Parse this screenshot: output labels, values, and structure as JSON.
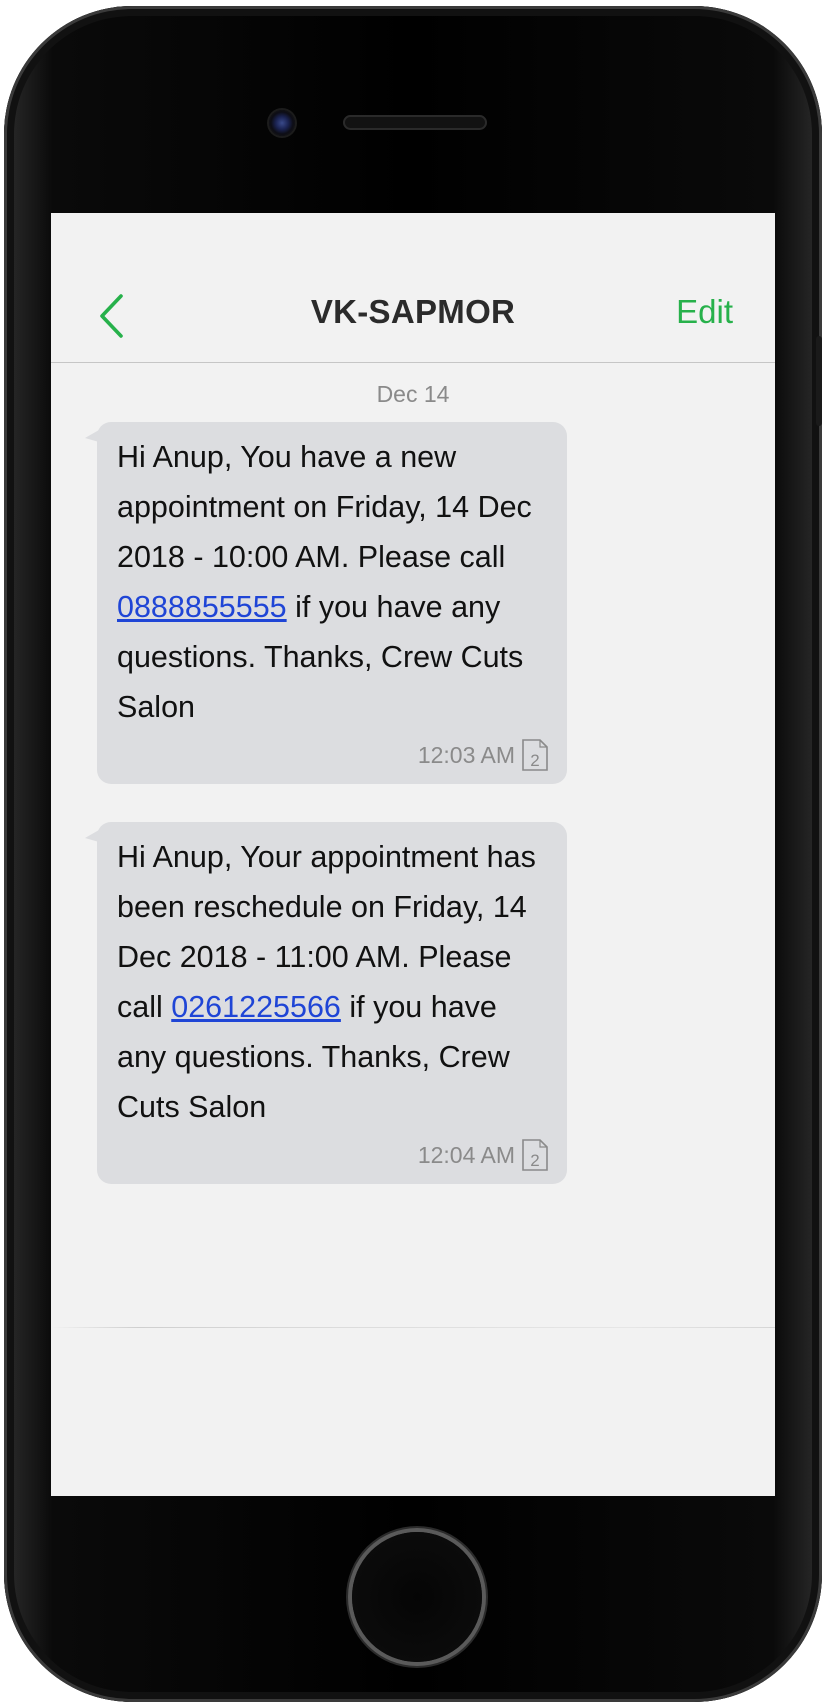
{
  "header": {
    "title": "VK-SAPMOR",
    "edit_label": "Edit",
    "back_icon": "chevron-left-icon",
    "accent_color": "#27b14b"
  },
  "conversation": {
    "date_label": "Dec 14",
    "messages": [
      {
        "text_before_link": "Hi Anup, You have a new appointment on Friday, 14 Dec 2018 - 10:00 AM. Please call ",
        "link": "0888855555",
        "text_after_link": " if you have any questions. Thanks, Crew Cuts Salon",
        "time": "12:03 AM",
        "sim_slot": "2"
      },
      {
        "text_before_link": "Hi Anup, Your appointment has been reschedule on Friday, 14 Dec 2018 - 11:00 AM. Please call ",
        "link": "0261225566",
        "text_after_link": " if you have any questions. Thanks, Crew Cuts Salon",
        "time": "12:04 AM",
        "sim_slot": "2"
      }
    ]
  },
  "colors": {
    "bubble": "#dcdde0",
    "link": "#1f45d6",
    "screen_background": "#f2f2f2"
  }
}
